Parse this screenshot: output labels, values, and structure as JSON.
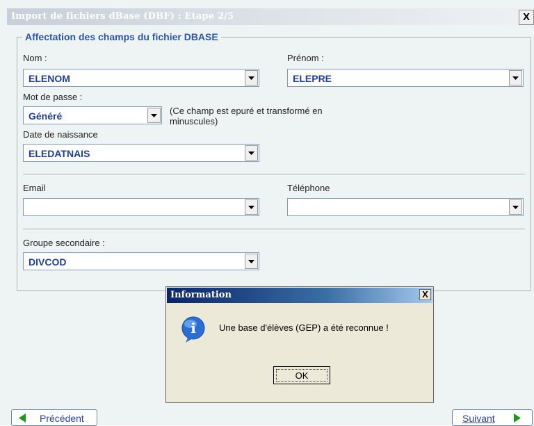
{
  "window": {
    "title": "Import de fichiers dBase (DBF) : Etape 2/5",
    "close_label": "X"
  },
  "group": {
    "legend": "Affectation des champs du fichier DBASE"
  },
  "fields": {
    "nom": {
      "label": "Nom :",
      "value": "ELENOM"
    },
    "prenom": {
      "label": "Prénom :",
      "value": "ELEPRE"
    },
    "mot_de_passe": {
      "label": "Mot de passe :",
      "value": "Généré",
      "note_line1": "(Ce champ est epuré et transformé en",
      "note_line2": "minuscules)"
    },
    "date_naissance": {
      "label": "Date de naissance",
      "value": "ELEDATNAIS"
    },
    "email": {
      "label": "Email",
      "value": ""
    },
    "telephone": {
      "label": "Téléphone",
      "value": ""
    },
    "groupe_secondaire": {
      "label": "Groupe secondaire :",
      "value": "DIVCOD"
    }
  },
  "nav": {
    "prev_label": "Précédent",
    "next_label": "Suivant"
  },
  "dialog": {
    "title": "Information",
    "message": "Une base d'élèves (GEP) a été reconnue !",
    "ok_label": "OK",
    "close_label": "X"
  },
  "colors": {
    "accent": "#2c55b0",
    "value_text": "#1e3f9c",
    "dialog_title": "#0a246a"
  }
}
